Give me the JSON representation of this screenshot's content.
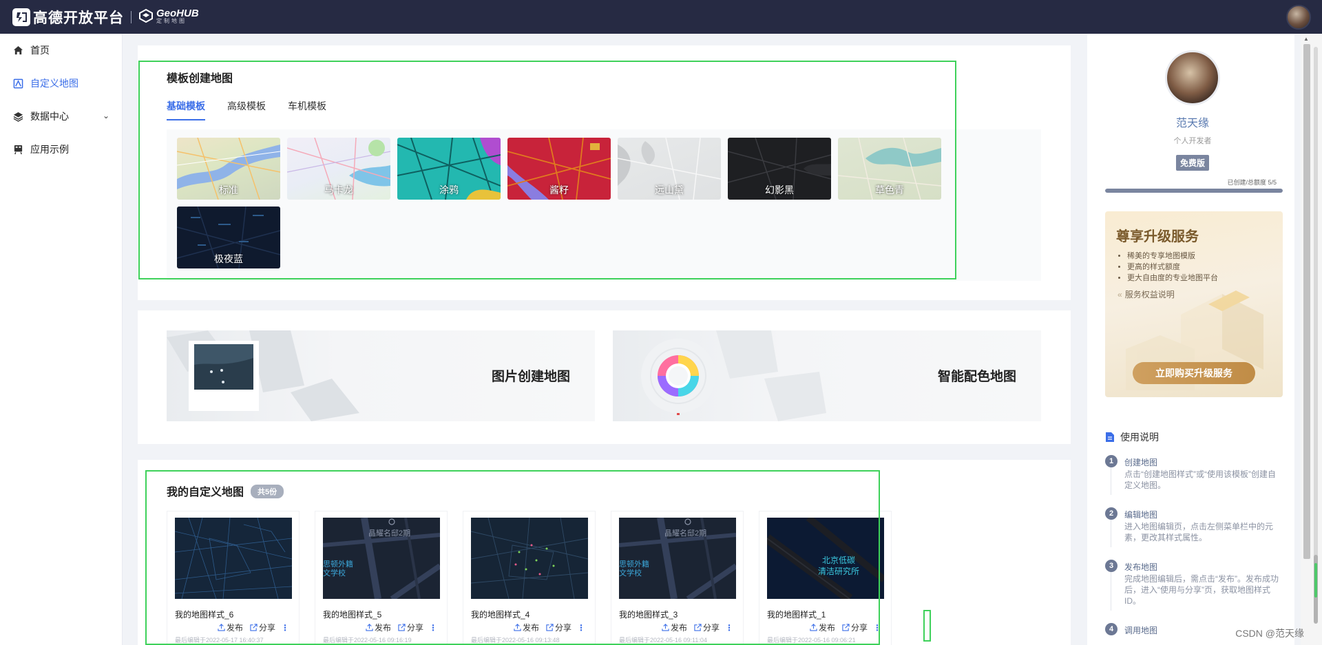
{
  "brand": {
    "name": "高德开放平台",
    "product": "GeoHUB",
    "product_sub": "定制地图"
  },
  "sidebar": {
    "items": [
      {
        "label": "首页",
        "icon": "home-icon",
        "active": false
      },
      {
        "label": "自定义地图",
        "icon": "custom-map-icon",
        "active": true
      },
      {
        "label": "数据中心",
        "icon": "layers-icon",
        "active": false,
        "expandable": true
      },
      {
        "label": "应用示例",
        "icon": "app-demo-icon",
        "active": false
      }
    ]
  },
  "template_section": {
    "title": "模板创建地图",
    "tabs": [
      {
        "label": "基础模板",
        "active": true
      },
      {
        "label": "高级模板",
        "active": false
      },
      {
        "label": "车机模板",
        "active": false
      }
    ],
    "templates": [
      {
        "label": "标准"
      },
      {
        "label": "马卡龙"
      },
      {
        "label": "涂鸦"
      },
      {
        "label": "酱籽"
      },
      {
        "label": "远山黛"
      },
      {
        "label": "幻影黑"
      },
      {
        "label": "草色青"
      },
      {
        "label": "极夜蓝"
      }
    ]
  },
  "create_section": {
    "image_map": "图片创建地图",
    "smart_color_map": "智能配色地图"
  },
  "my_maps": {
    "title": "我的自定义地图",
    "count_badge": "共5份",
    "publish_label": "发布",
    "share_label": "分享",
    "more_label": "⋮",
    "items": [
      {
        "name": "我的地图样式_6",
        "date": "最后编辑于2022-05-17 16:40:37",
        "style": "network"
      },
      {
        "name": "我的地图样式_5",
        "date": "最后编辑于2022-05-16 09:16:19",
        "style": "street",
        "poi": "晶耀名邸2期",
        "school": "思顿外籍\n文学校"
      },
      {
        "name": "我的地图样式_4",
        "date": "最后编辑于2022-05-16 09:13:48",
        "style": "dots"
      },
      {
        "name": "我的地图样式_3",
        "date": "最后编辑于2022-05-16 09:11:04",
        "style": "street",
        "poi": "晶耀名邸2期",
        "school": "思顿外籍\n文学校"
      },
      {
        "name": "我的地图样式_1",
        "date": "最后编辑于2022-05-16 09:06:21",
        "style": "dark",
        "poi": "北京低碳\n清洁研究所"
      }
    ]
  },
  "profile": {
    "name": "范天缘",
    "role": "个人开发者",
    "plan": "免费版",
    "quota_label": "已创建/总额度 5/5",
    "quota_fraction": 1.0
  },
  "upgrade": {
    "title": "尊享升级服务",
    "benefits": [
      "稀美的专享地图模版",
      "更高的样式额度",
      "更大自由度的专业地图平台"
    ],
    "link": "服务权益说明",
    "button": "立即购买升级服务"
  },
  "guide": {
    "title": "使用说明",
    "steps": [
      {
        "num": "1",
        "title": "创建地图",
        "desc": "点击“创建地图样式”或“使用该模板”创建自定义地图。"
      },
      {
        "num": "2",
        "title": "编辑地图",
        "desc": "进入地图编辑页，点击左侧菜单栏中的元素，更改其样式属性。"
      },
      {
        "num": "3",
        "title": "发布地图",
        "desc": "完成地图编辑后，需点击“发布”。发布成功后，进入“使用与分享”页，获取地图样式ID。"
      },
      {
        "num": "4",
        "title": "调用地图",
        "desc": ""
      }
    ]
  },
  "watermark": "CSDN @范天缘",
  "colors": {
    "accent": "#3b6ee8",
    "topbar": "#262a43",
    "highlight": "#3ed15a"
  }
}
